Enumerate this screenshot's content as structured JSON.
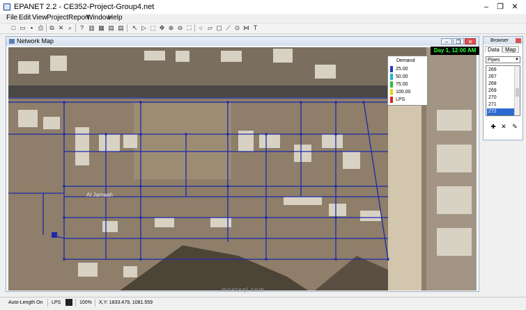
{
  "window": {
    "title": "EPANET 2.2 - CE352-Project-Group4.net",
    "minimize_glyph": "–",
    "maximize_glyph": "❐",
    "close_glyph": "✕"
  },
  "menu": [
    "File",
    "Edit",
    "View",
    "Project",
    "Report",
    "Window",
    "Help"
  ],
  "toolbar": {
    "icons": [
      "new-file-icon",
      "open-icon",
      "save-icon",
      "print-icon",
      "copy-icon",
      "delete-icon",
      "find-icon",
      "query-icon",
      "graph-icon",
      "table-icon",
      "options-icon",
      "select-object-icon",
      "select-vertex-icon",
      "select-region-icon",
      "pan-icon",
      "zoom-in-icon",
      "zoom-out-icon",
      "full-extent-icon",
      "add-junction-icon",
      "add-reservoir-icon",
      "add-tank-icon",
      "add-pipe-icon",
      "add-pump-icon",
      "add-valve-icon",
      "add-label-icon"
    ],
    "glyphs": [
      "□",
      "▭",
      "▪",
      "⎙",
      "⧉",
      "✕",
      "⌕",
      "?",
      "▥",
      "▦",
      "▤",
      "↖",
      "▷",
      "⬚",
      "✥",
      "⊕",
      "⊖",
      "⛶",
      "○",
      "▱",
      "▢",
      "⟋",
      "⊙",
      "⋈",
      "T"
    ]
  },
  "map_window": {
    "title": "Network Map",
    "time_display": "Day 1, 12:00 AM",
    "map_label": "Al Jamaah"
  },
  "legend": {
    "title": "Demand",
    "entries": [
      {
        "label": "25.00",
        "color": "#1f3fbf"
      },
      {
        "label": "50.00",
        "color": "#1fb7c9"
      },
      {
        "label": "75.00",
        "color": "#2fbf3a"
      },
      {
        "label": "100.00",
        "color": "#e8d21e"
      },
      {
        "label": "LPS",
        "color": "#d9261c"
      }
    ]
  },
  "browser": {
    "title": "Browser",
    "tabs": [
      "Data",
      "Map"
    ],
    "category": "Pipes",
    "items": [
      "266",
      "267",
      "268",
      "269",
      "270",
      "271",
      "272"
    ],
    "selected": "272",
    "actions": [
      "✚",
      "✕",
      "✎"
    ]
  },
  "status": {
    "auto_length": "Auto-Length On",
    "units": "LPS",
    "zoom": "100%",
    "coords": "X,Y: 1833.479, 1081.559"
  },
  "watermark": "mostaql.com",
  "colors": {
    "pipe": "#1b2aa8",
    "node": "#1b2aa8",
    "aerial_road": "#4a4844",
    "aerial_ground": "#8e7e6a",
    "aerial_sand": "#d2c6ae"
  }
}
